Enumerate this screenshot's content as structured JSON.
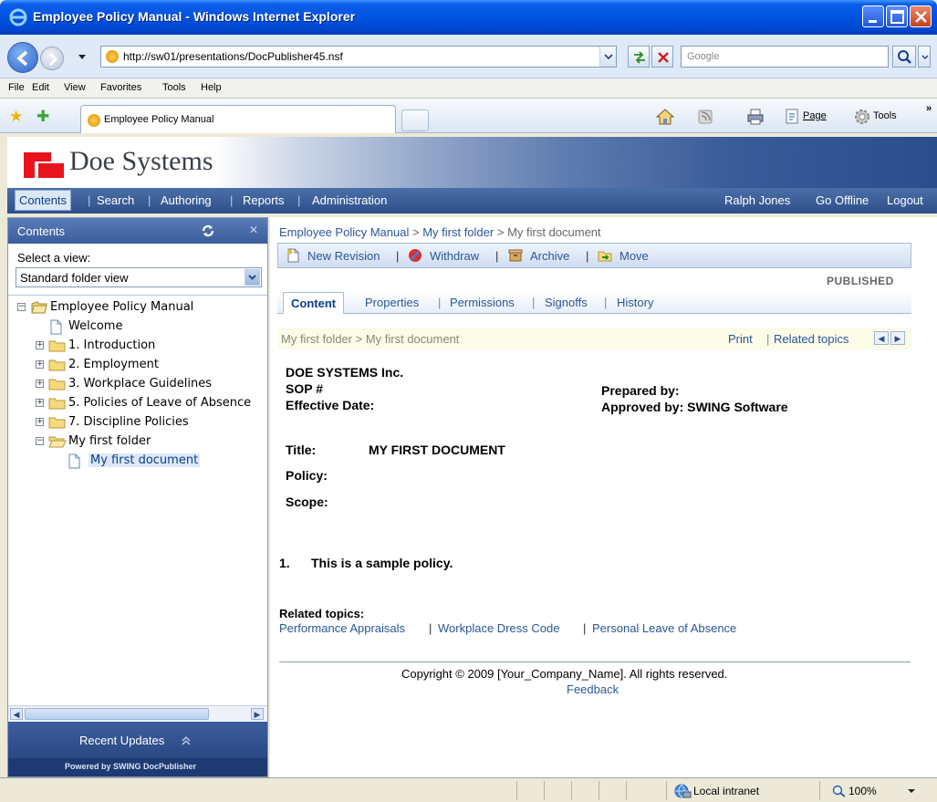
{
  "window": {
    "title": "Employee Policy Manual - Windows Internet Explorer"
  },
  "address": {
    "url": "http://sw01/presentations/DocPublisher45.nsf",
    "search_placeholder": "Google"
  },
  "menu": [
    "File",
    "Edit",
    "View",
    "Favorites",
    "Tools",
    "Help"
  ],
  "browser_tab": {
    "label": "Employee Policy Manual"
  },
  "command_bar": {
    "page": "Page",
    "tools": "Tools"
  },
  "app": {
    "brand": "Doe Systems",
    "nav": [
      "Contents",
      "Search",
      "Authoring",
      "Reports",
      "Administration"
    ],
    "user": "Ralph Jones",
    "go_offline": "Go Offline",
    "logout": "Logout"
  },
  "sidebar": {
    "title": "Contents",
    "view_label": "Select a view:",
    "view_value": "Standard folder view",
    "tree": [
      {
        "label": "Employee Policy Manual"
      },
      {
        "label": "Welcome"
      },
      {
        "label": "1. Introduction"
      },
      {
        "label": "2. Employment"
      },
      {
        "label": "3. Workplace Guidelines"
      },
      {
        "label": "5. Policies of Leave of Absence"
      },
      {
        "label": "7. Discipline Policies"
      },
      {
        "label": "My first folder"
      },
      {
        "label": "My first document"
      }
    ],
    "recent_updates": "Recent Updates",
    "powered_by": "Powered by SWING DocPublisher"
  },
  "main": {
    "breadcrumb": {
      "root": "Employee Policy Manual",
      "folder": "My first folder",
      "doc": "My first document"
    },
    "actions": [
      "New Revision",
      "Withdraw",
      "Archive",
      "Move"
    ],
    "status": "PUBLISHED",
    "tabs": [
      "Content",
      "Properties",
      "Permissions",
      "Signoffs",
      "History"
    ],
    "path": "My first folder > My first document",
    "print": "Print",
    "related_topics_link": "Related topics",
    "doc": {
      "company": "DOE SYSTEMS Inc.",
      "sop": "SOP #",
      "effective_date": "Effective Date:",
      "prepared_by": "Prepared by:",
      "approved_by": "Approved by: SWING Software",
      "title_label": "Title:",
      "title_value": "MY FIRST DOCUMENT",
      "policy_label": "Policy:",
      "scope_label": "Scope:",
      "item_number": "1.",
      "item_text": "This is a sample policy."
    },
    "related_heading": "Related topics:",
    "related": [
      "Performance Appraisals",
      "Workplace Dress Code",
      "Personal Leave of Absence"
    ],
    "copyright": "Copyright © 2009 [Your_Company_Name]. All rights reserved.",
    "feedback": "Feedback"
  },
  "statusbar": {
    "zone": "Local intranet",
    "zoom": "100%"
  }
}
